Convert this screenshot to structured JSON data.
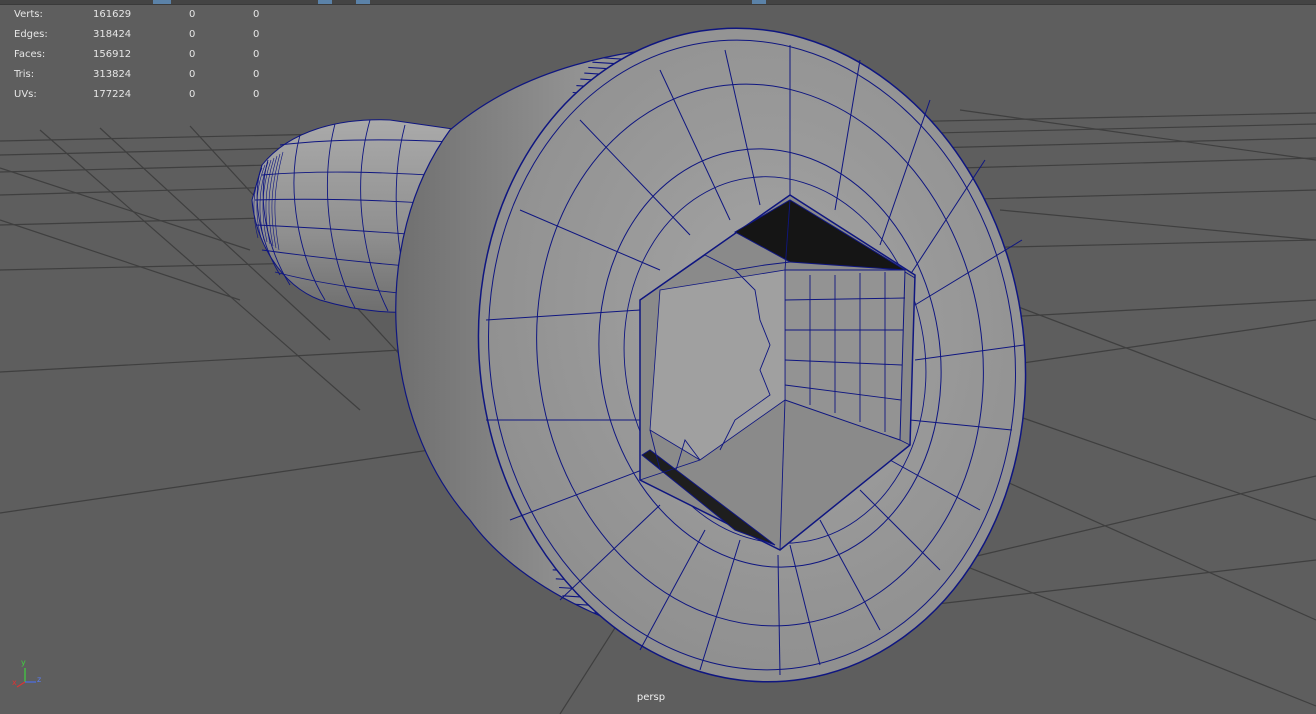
{
  "hud": {
    "rows": [
      {
        "label": "Verts:",
        "total": "161629",
        "sel": "0",
        "tri": "0"
      },
      {
        "label": "Edges:",
        "total": "318424",
        "sel": "0",
        "tri": "0"
      },
      {
        "label": "Faces:",
        "total": "156912",
        "sel": "0",
        "tri": "0"
      },
      {
        "label": "Tris:",
        "total": "313824",
        "sel": "0",
        "tri": "0"
      },
      {
        "label": "UVs:",
        "total": "177224",
        "sel": "0",
        "tri": "0"
      }
    ]
  },
  "viewport": {
    "camera": "persp",
    "background_color": "#5e5e5e",
    "grid_color": "#3c3c3c",
    "wire_color": "#0f1680",
    "mesh_color": "#9a9a9a"
  },
  "axis": {
    "y": "y",
    "x": "x",
    "z": "z"
  }
}
